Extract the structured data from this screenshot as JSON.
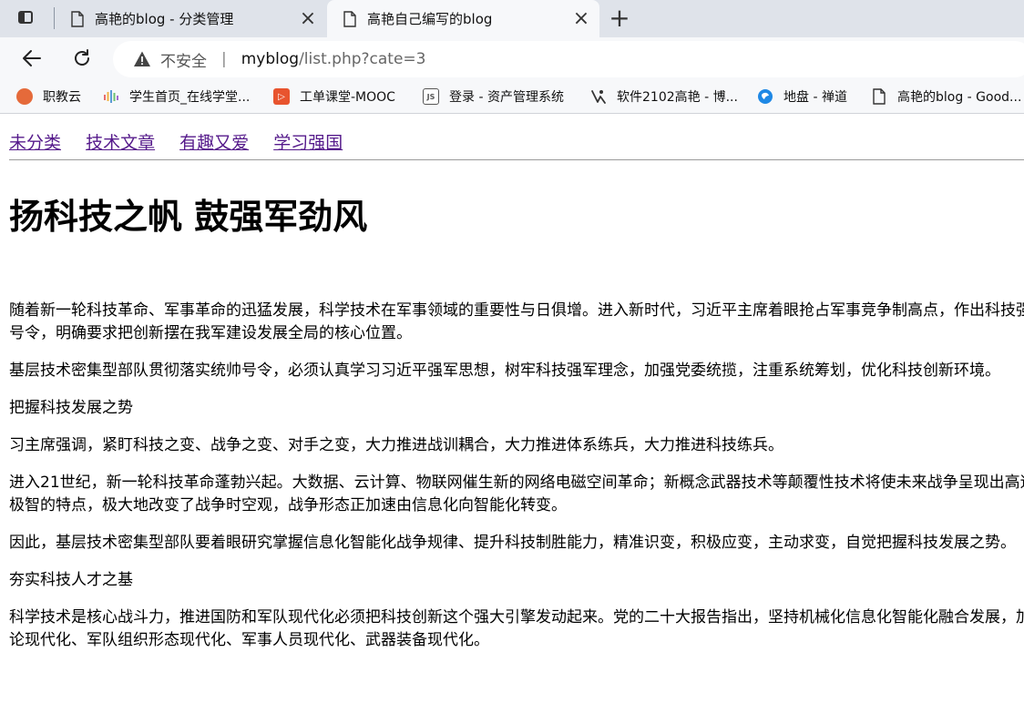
{
  "tabs": [
    {
      "title": "高艳的blog - 分类管理",
      "active": false
    },
    {
      "title": "高艳自己编写的blog",
      "active": true
    }
  ],
  "toolbar": {
    "back_icon": "arrow-left-icon",
    "reload_icon": "reload-icon",
    "security_label": "不安全",
    "url_host": "myblog",
    "url_path": "/list.php?cate=3"
  },
  "bookmarks": [
    {
      "label": "职教云",
      "icon": "zhijiaoyun-icon",
      "color": "#e56a3a"
    },
    {
      "label": "学生首页_在线学堂...",
      "icon": "bars-icon",
      "color": "#5b9bd5"
    },
    {
      "label": "工单课堂-MOOC",
      "icon": "mooc-icon",
      "color": "#e8542e"
    },
    {
      "label": "登录 - 资产管理系统",
      "icon": "js-icon",
      "color": "#555555"
    },
    {
      "label": "软件2102高艳 - 博...",
      "icon": "cnblogs-icon",
      "color": "#333333"
    },
    {
      "label": "地盘 - 禅道",
      "icon": "zentao-icon",
      "color": "#1e88e5"
    },
    {
      "label": "高艳的blog - Good...",
      "icon": "page-icon",
      "color": "#444444"
    }
  ],
  "nav": {
    "items": [
      "未分类",
      "技术文章",
      "有趣又爱",
      "学习强国"
    ],
    "link_color": "#551a8b"
  },
  "article": {
    "title": "扬科技之帆 鼓强军劲风",
    "paragraphs": [
      "随着新一轮科技革命、军事革命的迅猛发展，科学技术在军事领域的重要性与日俱增。进入新时代，习近平主席着眼抢占军事竞争制高点，作出科技强军的时代号令，明确要求把创新摆在我军建设发展全局的核心位置。",
      "基层技术密集型部队贯彻落实统帅号令，必须认真学习习近平强军思想，树牢科技强军理念，加强党委统揽，注重系统筹划，优化科技创新环境。",
      "把握科技发展之势",
      "习主席强调，紧盯科技之变、战争之变、对手之变，大力推进战训耦合，大力推进体系练兵，大力推进科技练兵。",
      "进入21世纪，新一轮科技革命蓬勃兴起。大数据、云计算、物联网催生新的网络电磁空间革命；新概念武器技术等颠覆性技术将使未来战争呈现出高速、精微和极智的特点，极大地改变了战争时空观，战争形态正加速由信息化向智能化转变。",
      "因此，基层技术密集型部队要着眼研究掌握信息化智能化战争规律、提升科技制胜能力，精准识变，积极应变，主动求变，自觉把握科技发展之势。",
      "夯实科技人才之基",
      "科学技术是核心战斗力，推进国防和军队现代化必须把科技创新这个强大引擎发动起来。党的二十大报告指出，坚持机械化信息化智能化融合发展，加快军事理论现代化、军队组织形态现代化、军事人员现代化、武器装备现代化。"
    ]
  }
}
